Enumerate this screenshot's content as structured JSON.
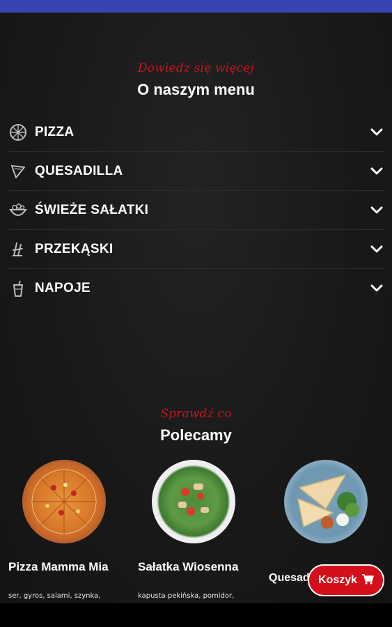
{
  "colors": {
    "accent_red": "#c4161c",
    "cart_red": "#d50f1a",
    "status_bar": "#3a43b4"
  },
  "about": {
    "kicker": "Dowiedz się więcej",
    "title": "O naszym menu"
  },
  "menu": {
    "items": [
      {
        "label": "PIZZA",
        "icon": "pizza-icon"
      },
      {
        "label": "QUESADILLA",
        "icon": "quesadilla-icon"
      },
      {
        "label": "ŚWIEŻE SAŁATKI",
        "icon": "salad-bowl-icon"
      },
      {
        "label": "PRZEKĄSKI",
        "icon": "snack-icon"
      },
      {
        "label": "NAPOJE",
        "icon": "drink-cup-icon"
      }
    ]
  },
  "recommended": {
    "kicker": "Sprawdź co",
    "title": "Polecamy",
    "items": [
      {
        "name": "Pizza Mamma Mia",
        "desc": "ser, gyros, salami, szynka,"
      },
      {
        "name": "Sałatka Wiosenna",
        "desc": "kapusta pekińska, pomidor,"
      },
      {
        "name": "Quesadilla gyrose",
        "desc": ""
      }
    ]
  },
  "cart": {
    "label": "Koszyk",
    "icon": "shopping-cart-icon"
  }
}
